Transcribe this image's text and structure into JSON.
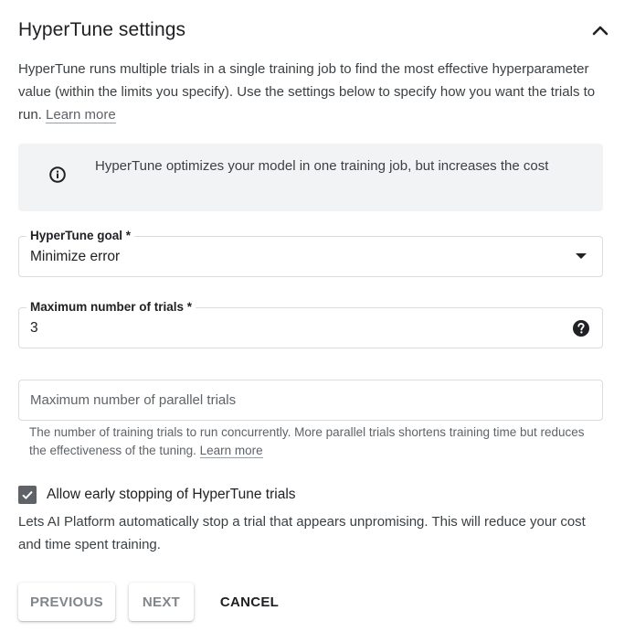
{
  "header": {
    "title": "HyperTune settings",
    "collapse_icon": "chevron-up-icon"
  },
  "description": {
    "text": "HyperTune runs multiple trials in a single training job to find the most effective hyperparameter value (within the limits you specify). Use the settings below to specify how you want the trials to run. ",
    "link": "Learn more"
  },
  "info_banner": {
    "icon": "info-icon",
    "text": "HyperTune optimizes your model in one training job, but increases the cost"
  },
  "fields": {
    "goal": {
      "label": "HyperTune goal *",
      "value": "Minimize error"
    },
    "max_trials": {
      "label": "Maximum number of trials *",
      "value": "3",
      "help_icon": "help-icon"
    },
    "max_parallel": {
      "placeholder": "Maximum number of parallel trials",
      "hint": "The number of training trials to run concurrently. More parallel trials shortens training time but reduces the effectiveness of the tuning. ",
      "hint_link": "Learn more"
    }
  },
  "early_stopping": {
    "checked": true,
    "label": "Allow early stopping of HyperTune trials",
    "description": "Lets AI Platform automatically stop a trial that appears unpromising. This will reduce your cost and time spent training."
  },
  "buttons": {
    "previous": "PREVIOUS",
    "next": "NEXT",
    "cancel": "CANCEL"
  },
  "colors": {
    "checkbox": "#5f6368",
    "info_bg": "#f1f3f4",
    "border": "#dadce0"
  }
}
